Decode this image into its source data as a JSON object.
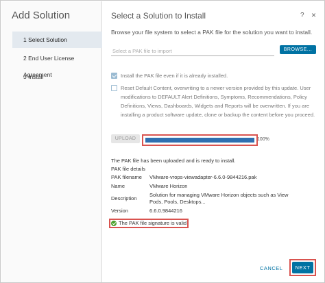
{
  "wizard": {
    "title": "Add Solution",
    "steps": [
      {
        "label": "1 Select Solution",
        "active": true
      },
      {
        "label": "2 End User License Agreement",
        "active": false
      },
      {
        "label": "3 Install",
        "active": false
      }
    ]
  },
  "panel": {
    "title": "Select a Solution to Install",
    "help_icon": "?",
    "close_icon": "×",
    "intro": "Browse your file system to select a PAK file for the solution you want to install.",
    "pak_input": {
      "placeholder": "Select a PAK file to import",
      "value": ""
    },
    "browse_label": "BROWSE...",
    "install_checkbox": {
      "label": "Install the PAK file even if it is already installed.",
      "checked": true
    },
    "reset_checkbox": {
      "label": "Reset Default Content, overwriting to a newer version provided by this update. User modifications to DEFAULT Alert Definitions, Symptoms, Recommendations, Policy Definitions, Views, Dashboards, Widgets and Reports will be overwritten. If you are installing a product software update, clone or backup the content before you proceed.",
      "checked": false
    },
    "upload_label": "UPLOAD",
    "progress": {
      "value": 1.0,
      "label": "100%"
    },
    "status_message": "The PAK file has been uploaded and is ready to install.",
    "details_heading": "PAK file details",
    "details": [
      {
        "label": "PAK filename",
        "value": "VMware-vrops-viewadapter-6.6.0-9844216.pak"
      },
      {
        "label": "Name",
        "value": "VMware Horizon"
      },
      {
        "label": "Description",
        "value": "Solution for managing VMware Horizon objects such as View Pods, Pools, Desktops..."
      },
      {
        "label": "Version",
        "value": "6.6.0.9844216"
      }
    ],
    "signature_message": "The PAK file signature is valid",
    "cancel_label": "CANCEL",
    "next_label": "NEXT"
  },
  "colors": {
    "accent": "#0072a3",
    "highlight": "#d9534f",
    "progress": "#2f6fb0",
    "success": "#4aa02c"
  }
}
